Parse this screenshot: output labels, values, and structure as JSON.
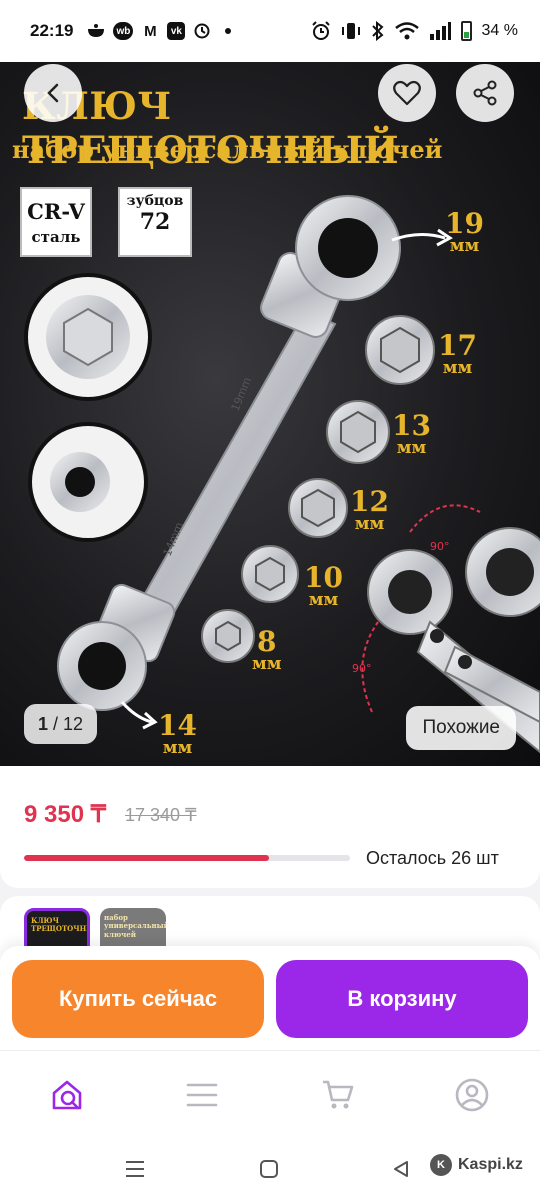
{
  "status_bar": {
    "time": "22:19",
    "battery": "34 %",
    "notification_icons": [
      "wb",
      "M",
      "vk"
    ]
  },
  "product_image": {
    "title": "КЛЮЧ ТРЕЩОТОЧНЫЙ",
    "subtitle": "набор универсальный ключей",
    "badge_material_line1": "CR-V",
    "badge_material_line2": "сталь",
    "badge_teeth_line1": "зубцов",
    "badge_teeth_line2": "72",
    "wrench_markings": [
      "19mm",
      "14mm"
    ],
    "angle_markings": [
      "90°",
      "90°"
    ],
    "sizes": [
      {
        "num": "19",
        "unit": "мм"
      },
      {
        "num": "17",
        "unit": "мм"
      },
      {
        "num": "13",
        "unit": "мм"
      },
      {
        "num": "12",
        "unit": "мм"
      },
      {
        "num": "10",
        "unit": "мм"
      },
      {
        "num": "8",
        "unit": "мм"
      },
      {
        "num": "14",
        "unit": "мм"
      }
    ],
    "counter_current": "1",
    "counter_total": "/ 12",
    "similar_label": "Похожие"
  },
  "price": {
    "current": "9 350 ₸",
    "old": "17 340 ₸",
    "stock_label": "Осталось 26 шт",
    "stock_fraction": 0.75
  },
  "thumbnails": {
    "title_line1": "КЛЮЧ ТРЕЩОТОЧНЫЙ",
    "title_line2": "набор универсальный ключей"
  },
  "actions": {
    "buy_now": "Купить сейчас",
    "add_to_cart": "В корзину"
  },
  "bottom_nav": {
    "items": [
      "home-search-icon",
      "menu-icon",
      "cart-icon",
      "profile-icon"
    ],
    "active_color": "#9b27e8",
    "inactive_color": "#b8b8c0"
  },
  "watermark": {
    "text": "Kaspi.kz"
  },
  "colors": {
    "price": "#e0334f",
    "buy": "#f7852c",
    "cart": "#9b27e8",
    "hero_text": "#e7b52c"
  }
}
